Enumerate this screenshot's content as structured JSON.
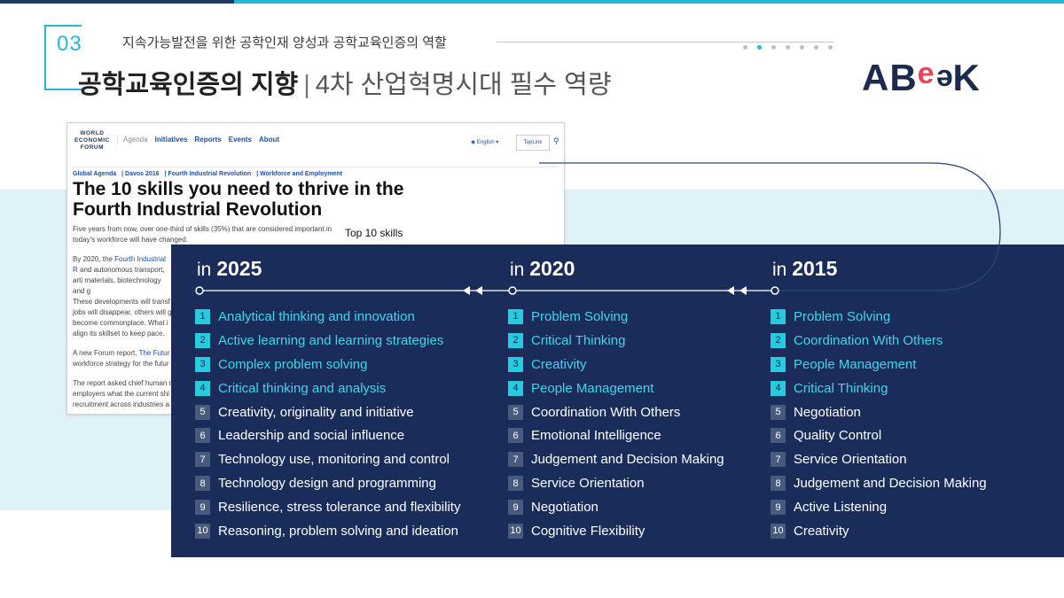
{
  "header": {
    "section_number": "03",
    "subtitle": "지속가능발전을 위한 공학인재 양성과 공학교육인증의 역할",
    "title_main": "공학교육인증의 지향",
    "title_sep": "|",
    "title_sub": "4차 산업혁명시대 필수 역량",
    "logo": {
      "a": "AB",
      "e": "e",
      "inv": "e",
      "k": "K"
    }
  },
  "article": {
    "logo_lines": [
      "WORLD",
      "ECONOMIC",
      "FORUM"
    ],
    "nav": [
      "Agenda",
      "Initiatives",
      "Reports",
      "Events",
      "About"
    ],
    "language": "English",
    "toplink": "TopLink",
    "breadcrumb": [
      "Global Agenda",
      "Davos 2016",
      "Fourth Industrial Revolution",
      "Workforce and Employment"
    ],
    "headline": "The 10 skills you need to thrive in the Fourth Industrial Revolution",
    "p1": "Five years from now, over one-third of skills (35%) that are considered important in today's workforce will have changed.",
    "p2_start": "By 2020, the ",
    "p2_link": "Fourth Industrial R",
    "p2_rest": "and autonomous transport, arti materials, biotechnology and g",
    "p3": "These developments will transf jobs will disappear, others will g become commonplace. What i align its skillset to keep pace.",
    "p4_start": "A new Forum report, ",
    "p4_link": "The Futur",
    "p4_rest": "workforce strategy for the futur",
    "p5": "The report asked chief human r employers what the current shi recruitment across industries a"
  },
  "top10_label": "Top 10 skills",
  "columns": [
    {
      "prefix": "in",
      "year": "2025",
      "skills": [
        "Analytical thinking and innovation",
        "Active learning and learning strategies",
        "Complex problem solving",
        "Critical thinking and analysis",
        "Creativity, originality and initiative",
        "Leadership and social influence",
        "Technology use, monitoring and control",
        "Technology design and programming",
        "Resilience, stress tolerance and flexibility",
        "Reasoning, problem solving and ideation"
      ]
    },
    {
      "prefix": "in",
      "year": "2020",
      "skills": [
        "Problem Solving",
        "Critical Thinking",
        "Creativity",
        "People Management",
        "Coordination With Others",
        "Emotional Intelligence",
        "Judgement and Decision Making",
        "Service Orientation",
        "Negotiation",
        "Cognitive Flexibility"
      ]
    },
    {
      "prefix": "in",
      "year": "2015",
      "skills": [
        "Problem Solving",
        "Coordination With Others",
        "People Management",
        "Critical Thinking",
        "Negotiation",
        "Quality Control",
        "Service Orientation",
        "Judgement and Decision Making",
        "Active Listening",
        "Creativity"
      ]
    }
  ],
  "highlight_count": 4,
  "colors": {
    "accent": "#27b7d6",
    "panel": "#1a2d5a",
    "highlight": "#3fd6ea",
    "logo_e": "#e8445a"
  }
}
